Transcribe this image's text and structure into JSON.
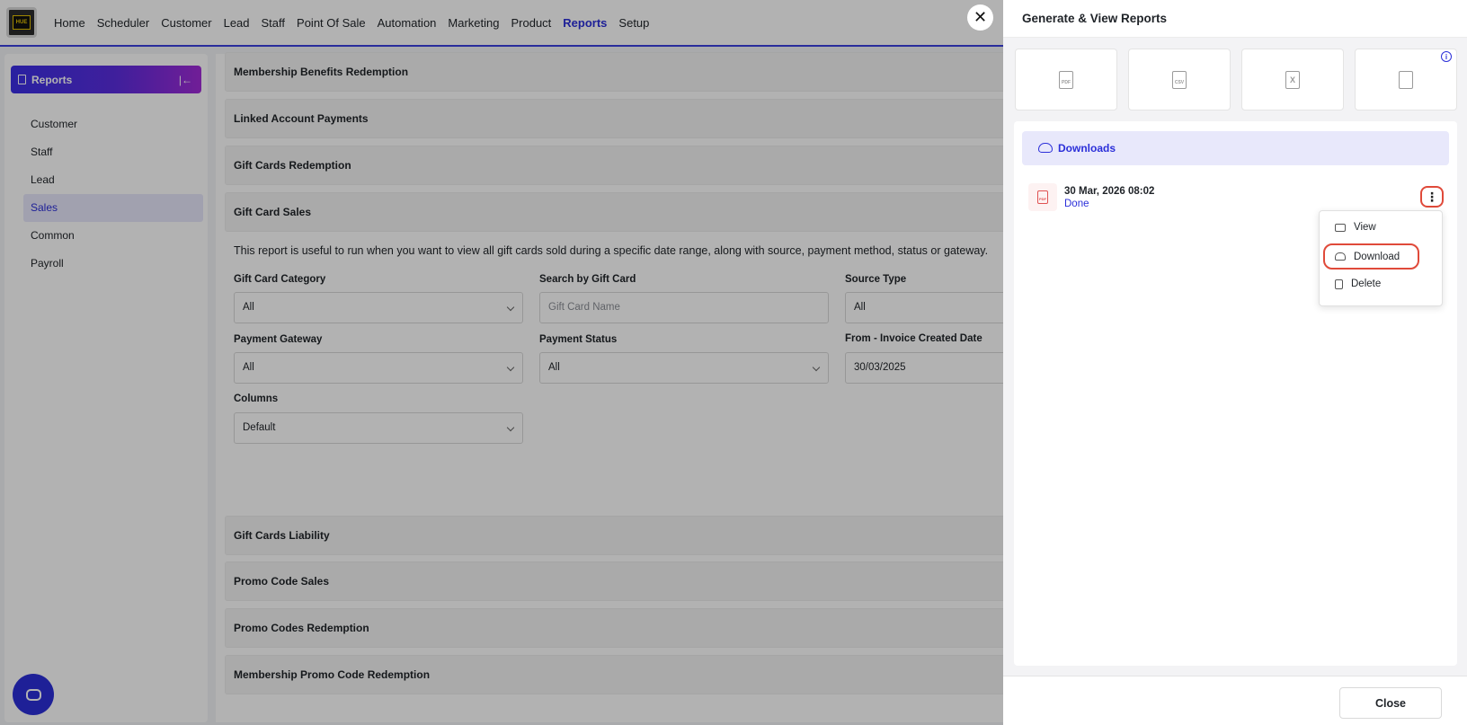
{
  "nav": {
    "items": [
      "Home",
      "Scheduler",
      "Customer",
      "Lead",
      "Staff",
      "Point Of Sale",
      "Automation",
      "Marketing",
      "Product",
      "Reports",
      "Setup"
    ],
    "active_index": 9
  },
  "sidebar": {
    "title": "Reports",
    "items": [
      "Customer",
      "Staff",
      "Lead",
      "Sales",
      "Common",
      "Payroll"
    ],
    "active_index": 3
  },
  "main": {
    "sections_top": [
      "Membership Benefits Redemption",
      "Linked Account Payments",
      "Gift Cards Redemption",
      "Gift Card Sales"
    ],
    "description": "This report is useful to run when you want to view all gift cards sold during a specific date range, along with source, payment method, status or gateway.",
    "fields": {
      "gift_card_category": {
        "label": "Gift Card Category",
        "value": "All"
      },
      "search_gift_card": {
        "label": "Search by Gift Card",
        "placeholder": "Gift Card Name"
      },
      "source_type": {
        "label": "Source Type",
        "value": "All"
      },
      "payment_gateway": {
        "label": "Payment Gateway",
        "value": "All"
      },
      "payment_status": {
        "label": "Payment Status",
        "value": "All"
      },
      "from_invoice_date": {
        "label": "From - Invoice Created Date",
        "value": "30/03/2025"
      },
      "columns": {
        "label": "Columns",
        "value": "Default"
      }
    },
    "sections_bottom": [
      "Gift Cards Liability",
      "Promo Code Sales",
      "Promo Codes Redemption",
      "Membership Promo Code Redemption"
    ]
  },
  "panel": {
    "title": "Generate & View Reports",
    "formats": [
      "pdf-icon",
      "csv-icon",
      "excel-icon",
      "contact-file-icon"
    ],
    "downloads_label": "Downloads",
    "entry": {
      "date": "30 Mar, 2026 08:02",
      "status": "Done"
    },
    "menu": {
      "view": "View",
      "download": "Download",
      "delete": "Delete"
    },
    "close_label": "Close"
  },
  "colors": {
    "accent": "#2b2fd9",
    "highlight": "#e04a3a",
    "active_bg": "#e7e7fb"
  }
}
